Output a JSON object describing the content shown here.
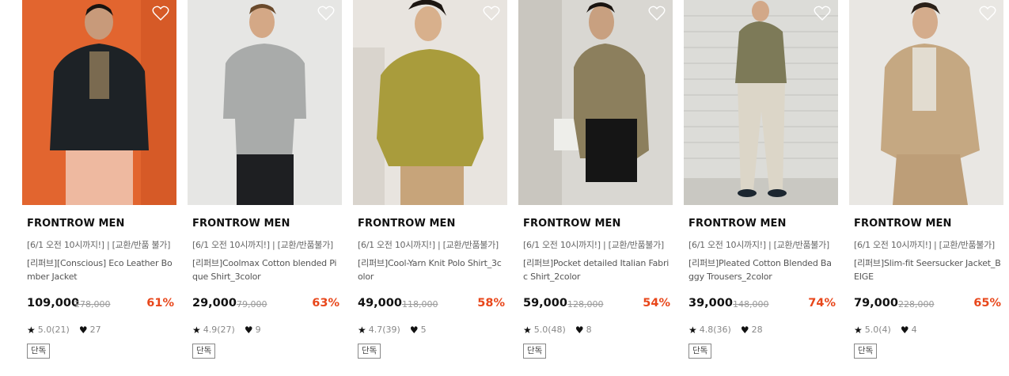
{
  "products": [
    {
      "brand": "FRONTROW MEN",
      "promo": "[6/1 오전 10시까지!] | [교환/반품 불가]",
      "name": "[리퍼브][Conscious] Eco Leather Bomber Jacket",
      "price": "109,000",
      "original_price": "278,000",
      "discount": "61%",
      "rating": "5.0(21)",
      "likes": "27",
      "badge": "단독"
    },
    {
      "brand": "FRONTROW MEN",
      "promo": "[6/1 오전 10시까지!] | [교환/반품불가]",
      "name": "[리퍼브]Coolmax Cotton blended Pique Shirt_3color",
      "price": "29,000",
      "original_price": "79,000",
      "discount": "63%",
      "rating": "4.9(27)",
      "likes": "9",
      "badge": "단독"
    },
    {
      "brand": "FRONTROW MEN",
      "promo": "[6/1 오전 10시까지!] | [교환/반품불가]",
      "name": "[리퍼브]Cool-Yarn Knit Polo Shirt_3color",
      "price": "49,000",
      "original_price": "118,000",
      "discount": "58%",
      "rating": "4.7(39)",
      "likes": "5",
      "badge": "단독"
    },
    {
      "brand": "FRONTROW MEN",
      "promo": "[6/1 오전 10시까지!] | [교환/반품불가]",
      "name": "[리퍼브]Pocket detailed Italian Fabric Shirt_2color",
      "price": "59,000",
      "original_price": "128,000",
      "discount": "54%",
      "rating": "5.0(48)",
      "likes": "8",
      "badge": "단독"
    },
    {
      "brand": "FRONTROW MEN",
      "promo": "[6/1 오전 10시까지!] | [교환/반품불가]",
      "name": "[리퍼브]Pleated Cotton Blended Baggy Trousers_2color",
      "price": "39,000",
      "original_price": "148,000",
      "discount": "74%",
      "rating": "4.8(36)",
      "likes": "28",
      "badge": "단독"
    },
    {
      "brand": "FRONTROW MEN",
      "promo": "[6/1 오전 10시까지!] | [교환/반품불가]",
      "name": "[리퍼브]Slim-fit Seersucker Jacket_BEIGE",
      "price": "79,000",
      "original_price": "228,000",
      "discount": "65%",
      "rating": "5.0(4)",
      "likes": "4",
      "badge": "단독"
    }
  ]
}
